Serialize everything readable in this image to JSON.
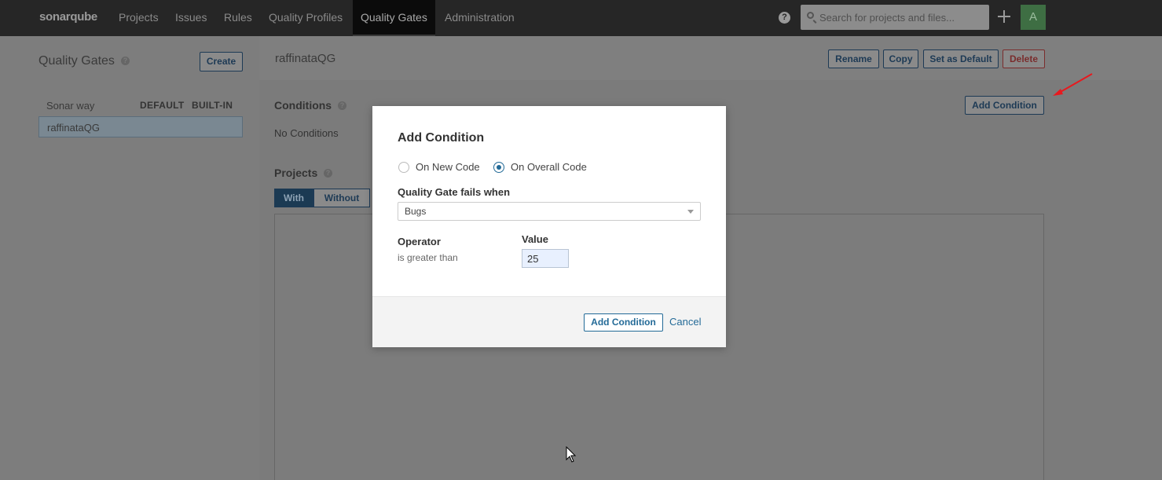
{
  "nav": {
    "logo": "sonarqube",
    "items": [
      "Projects",
      "Issues",
      "Rules",
      "Quality Profiles",
      "Quality Gates",
      "Administration"
    ],
    "active": "Quality Gates",
    "help": "?",
    "search_placeholder": "Search for projects and files...",
    "avatar_letter": "A"
  },
  "sidebar": {
    "title": "Quality Gates",
    "create_label": "Create",
    "gates": [
      {
        "name": "Sonar way",
        "badges": [
          "DEFAULT",
          "BUILT-IN"
        ]
      },
      {
        "name": "raffinataQG",
        "badges": []
      }
    ]
  },
  "main": {
    "gate_name": "raffinataQG",
    "actions": {
      "rename": "Rename",
      "copy": "Copy",
      "set_default": "Set as Default",
      "delete": "Delete"
    },
    "conditions": {
      "title": "Conditions",
      "add_label": "Add Condition",
      "empty_text": "No Conditions"
    },
    "projects": {
      "title": "Projects",
      "tabs": [
        "With",
        "Without"
      ]
    }
  },
  "modal": {
    "title": "Add Condition",
    "radio_new": "On New Code",
    "radio_overall": "On Overall Code",
    "selected_scope": "overall",
    "fails_when_label": "Quality Gate fails when",
    "metric": "Bugs",
    "operator_label": "Operator",
    "operator_value": "is greater than",
    "value_label": "Value",
    "value": "25",
    "submit_label": "Add Condition",
    "cancel_label": "Cancel"
  },
  "colors": {
    "accent": "#236a97",
    "nav_bg": "#262626",
    "annotation_arrow": "#e8191e"
  }
}
